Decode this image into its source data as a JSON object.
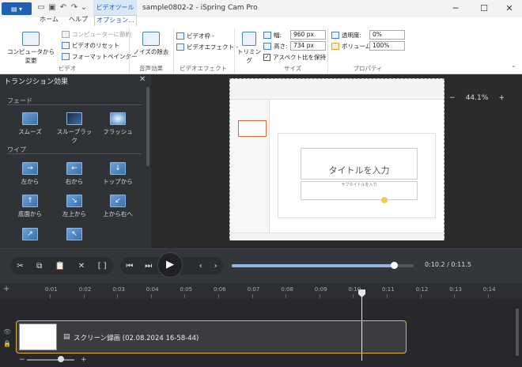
{
  "app": {
    "window_title": "sample0802-2 - iSpring Cam Pro",
    "context_tab_label": "ビデオツール"
  },
  "tabs": [
    {
      "label": "ホーム"
    },
    {
      "label": "ヘルプ"
    },
    {
      "label": "オプション..."
    }
  ],
  "ribbon": {
    "video": {
      "copy_from_computer": "コンピュータから変更",
      "save_to_computer": "コンピューターに節約",
      "reset_video": "ビデオのリセット",
      "format_painter": "フォーマットペインター",
      "group_label": "ビデオ"
    },
    "audio": {
      "noise_removal": "ノイズの除去",
      "group_label": "音声効果"
    },
    "effects": {
      "video_frame": "ビデオ枠 -",
      "video_effect": "ビデオエフェクト -",
      "group_label": "ビデオエフェクト"
    },
    "size": {
      "trim": "トリミング",
      "width_label": "幅:",
      "width_value": "960 px",
      "height_label": "高さ:",
      "height_value": "734 px",
      "keep_aspect": "アスペクト比を保持",
      "group_label": "サイズ"
    },
    "properties": {
      "opacity_label": "透明度:",
      "opacity_value": "0%",
      "volume_label": "ボリューム:",
      "volume_value": "100%",
      "group_label": "プロパティ"
    }
  },
  "transitions": {
    "title": "トランジション効果",
    "sections": [
      {
        "name": "フェード",
        "items": [
          "スムーズ",
          "スルーブラック",
          "フラッシュ"
        ]
      },
      {
        "name": "ワイプ",
        "items": [
          "左から",
          "右から",
          "トップから",
          "底面から",
          "左上から",
          "上から右へ"
        ]
      }
    ]
  },
  "canvas": {
    "slide_title": "タイトルを入力",
    "slide_subtitle": "サブタイトルを入力",
    "zoom": "44.1%"
  },
  "playback": {
    "current_time": "0:10.2",
    "total_time": "0:11.5",
    "time_display": "0:10.2 / 0:11.5",
    "progress": 0.89
  },
  "timeline": {
    "ticks": [
      "0:01",
      "0:02",
      "0:03",
      "0:04",
      "0:05",
      "0:06",
      "0:07",
      "0:08",
      "0:09",
      "0:10",
      "0:11",
      "0:12",
      "0:13",
      "0:14"
    ],
    "clip_label": "スクリーン録画 (02.08.2024 16-58-44)"
  },
  "colors": {
    "accent": "#1f5fb4",
    "clip_border": "#d8b24a",
    "dark_bg": "#2b2b2b"
  }
}
